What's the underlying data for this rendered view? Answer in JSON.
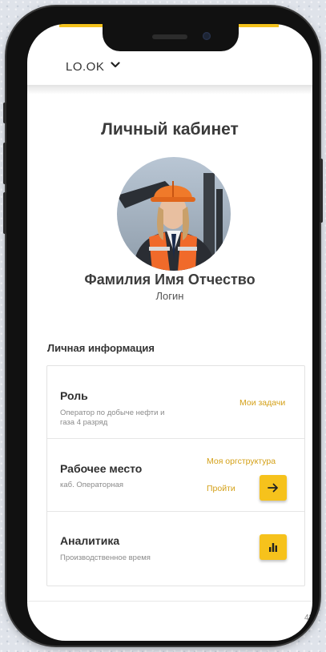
{
  "app": {
    "brand": "LO.OK"
  },
  "page": {
    "title": "Личный кабинет"
  },
  "profile": {
    "name": "Фамилия Имя Отчество",
    "login": "Логин"
  },
  "personal_info": {
    "section_title": "Личная информация",
    "rows": [
      {
        "title": "Роль",
        "subtitle": "Оператор по добыче нефти и газа 4 разряд",
        "link": "Мои задачи"
      },
      {
        "title": "Рабочее место",
        "subtitle": "каб. Операторная",
        "link": "Моя оргструктура",
        "action_label": "Пройти",
        "button_icon": "arrow-right-icon"
      },
      {
        "title": "Аналитика",
        "subtitle": "Производственное время",
        "button_icon": "bar-chart-icon"
      }
    ]
  },
  "footer": {
    "corner_text": "42"
  },
  "colors": {
    "accent": "#f6c21c",
    "link": "#d4a017",
    "phone_frame": "#111111"
  }
}
